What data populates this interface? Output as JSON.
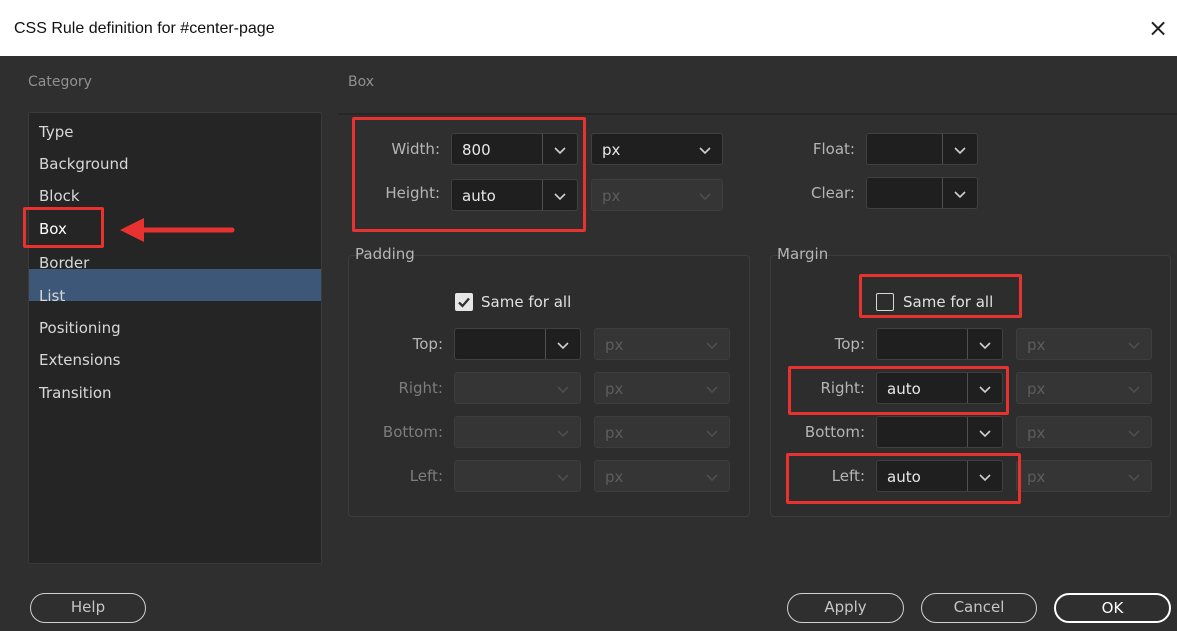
{
  "dialog": {
    "title": "CSS Rule definition for #center-page",
    "close_glyph": "×"
  },
  "category": {
    "label": "Category",
    "items": [
      {
        "label": "Type"
      },
      {
        "label": "Background"
      },
      {
        "label": "Block"
      },
      {
        "label": "Box"
      },
      {
        "label": "Border"
      },
      {
        "label": "List"
      },
      {
        "label": "Positioning"
      },
      {
        "label": "Extensions"
      },
      {
        "label": "Transition"
      }
    ],
    "selected": "Box"
  },
  "box": {
    "section_label": "Box",
    "width": {
      "label": "Width:",
      "value": "800",
      "unit": "px"
    },
    "height": {
      "label": "Height:",
      "value": "auto",
      "unit": "px"
    },
    "float": {
      "label": "Float:",
      "value": ""
    },
    "clear": {
      "label": "Clear:",
      "value": ""
    }
  },
  "padding": {
    "title": "Padding",
    "same_for_all": {
      "label": "Same for all",
      "checked": true
    },
    "top": {
      "label": "Top:",
      "value": "",
      "unit": "px"
    },
    "right": {
      "label": "Right:",
      "value": "",
      "unit": "px"
    },
    "bottom": {
      "label": "Bottom:",
      "value": "",
      "unit": "px"
    },
    "left": {
      "label": "Left:",
      "value": "",
      "unit": "px"
    }
  },
  "margin": {
    "title": "Margin",
    "same_for_all": {
      "label": "Same for all",
      "checked": false
    },
    "top": {
      "label": "Top:",
      "value": "",
      "unit": "px"
    },
    "right": {
      "label": "Right:",
      "value": "auto",
      "unit": "px"
    },
    "bottom": {
      "label": "Bottom:",
      "value": "",
      "unit": "px"
    },
    "left": {
      "label": "Left:",
      "value": "auto",
      "unit": "px"
    }
  },
  "buttons": {
    "help": "Help",
    "apply": "Apply",
    "cancel": "Cancel",
    "ok": "OK"
  },
  "colors": {
    "dialog_bg": "#2f2f2f",
    "selection": "#3c5777",
    "annotation": "#e8322f"
  }
}
